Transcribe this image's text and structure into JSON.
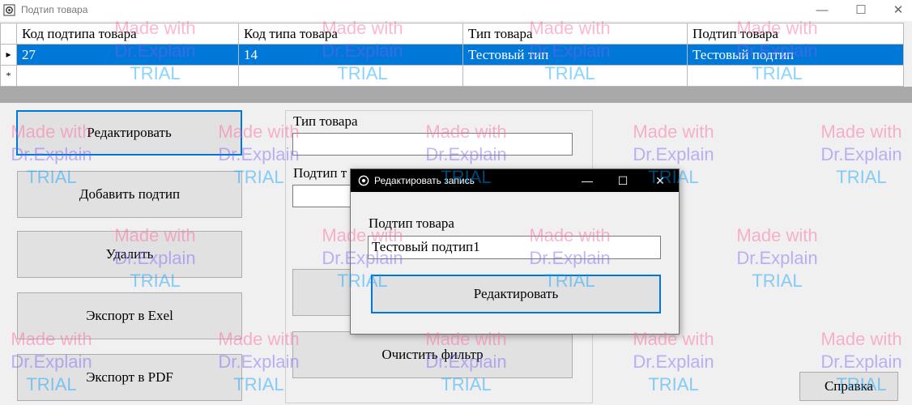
{
  "window": {
    "title": "Подтип товара",
    "minimize": "—",
    "maximize": "☐",
    "close": "✕"
  },
  "grid": {
    "columns": [
      "Код подтипа товара",
      "Код типа товара",
      "Тип товара",
      "Подтип товара"
    ],
    "rows": [
      {
        "marker": "▸",
        "cells": [
          "27",
          "14",
          "Тестовый тип",
          "Тестовый подтип"
        ]
      },
      {
        "marker": "*",
        "cells": [
          "",
          "",
          "",
          ""
        ]
      }
    ]
  },
  "buttons": {
    "edit": "Редактировать",
    "add_subtype": "Добавить подтип",
    "delete": "Удалить",
    "export_excel": "Экспорт в Exel",
    "export_pdf": "Экспорт в PDF",
    "clear_filter": "Очистить фильтр",
    "help": "Справка"
  },
  "filter": {
    "type_label": "Тип товара",
    "type_value": "",
    "subtype_label": "Подтип т",
    "subtype_value": ""
  },
  "dialog": {
    "title": "Редактировать запись",
    "minimize": "—",
    "maximize": "☐",
    "close": "✕",
    "field_label": "Подтип товара",
    "field_value": "Тестовый подтип1",
    "submit": "Редактировать"
  },
  "watermark": {
    "line1": "Made with",
    "line2": "Dr.Explain",
    "line3": "TRIAL"
  }
}
